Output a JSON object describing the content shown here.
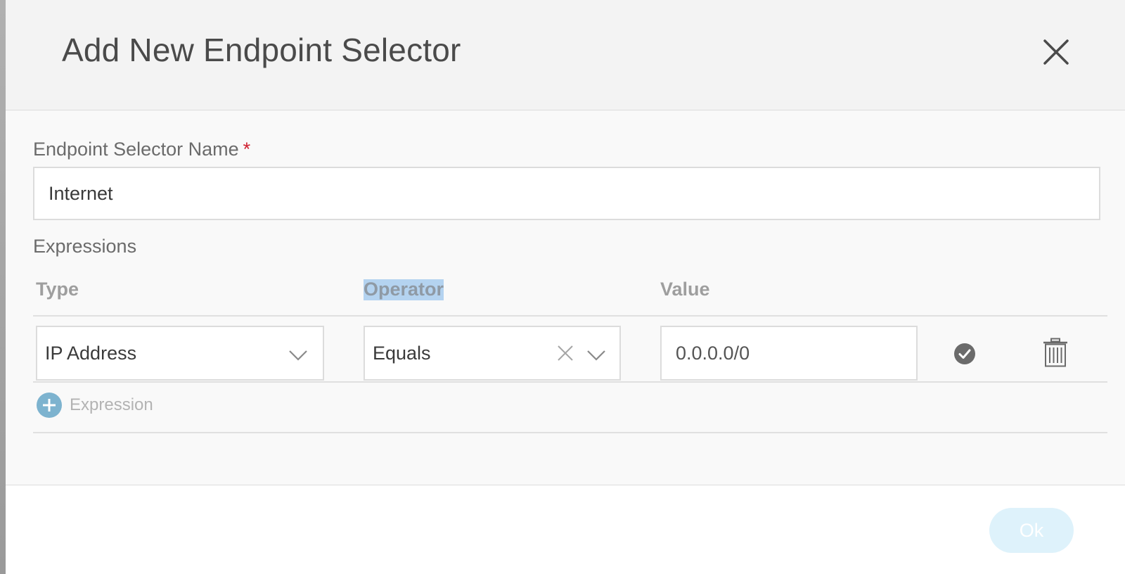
{
  "modal": {
    "title": "Add New Endpoint Selector"
  },
  "name_field": {
    "label": "Endpoint Selector Name",
    "required_marker": "*",
    "value": "Internet"
  },
  "expressions": {
    "section_label": "Expressions",
    "columns": {
      "type": "Type",
      "operator": "Operator",
      "value": "Value"
    },
    "rows": [
      {
        "type": "IP Address",
        "operator": "Equals",
        "value": "0.0.0.0/0"
      }
    ],
    "add_label": "Expression"
  },
  "footer": {
    "ok_label": "Ok"
  },
  "colors": {
    "accent_blue": "#7db3cf",
    "required_red": "#cf2030",
    "ok_button_bg": "#def2fb",
    "confirm_icon": "#6b6b6b",
    "selection_highlight": "#b4d3f0"
  },
  "icons": {
    "close": "close-icon",
    "chevron": "chevron-down-icon",
    "clear": "clear-icon",
    "confirm": "check-circle-icon",
    "delete": "trash-icon",
    "add": "plus-circle-icon"
  }
}
